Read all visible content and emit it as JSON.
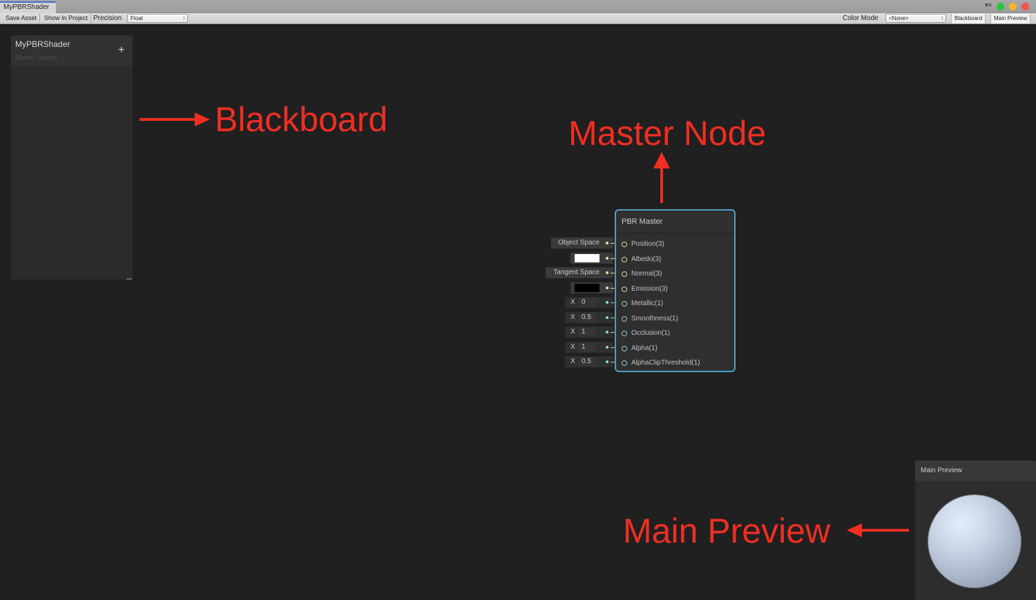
{
  "window": {
    "tab_title": "MyPBRShader",
    "controls": {
      "tab_menu_icon": "tab-menu-icon",
      "green": "#2fc23a",
      "yellow": "#f5b82a",
      "red": "#f25450"
    }
  },
  "toolbar": {
    "save_asset": "Save Asset",
    "show_in_project": "Show In Project",
    "precision_label": "Precision",
    "precision_value": "Float",
    "color_mode_label": "Color Mode",
    "color_mode_value": "<None>",
    "blackboard_toggle": "Blackboard",
    "main_preview_toggle": "Main Preview",
    "dropdown_arrow": "↕"
  },
  "blackboard": {
    "title": "MyPBRShader",
    "subtitle": "Shader Graphs",
    "add_icon": "+"
  },
  "annotations": {
    "color": "#f12e22",
    "blackboard": "Blackboard",
    "master_node": "Master Node",
    "main_preview": "Main Preview"
  },
  "master_node": {
    "title": "PBR Master",
    "accent": "#4da3c8",
    "ports": [
      {
        "label": "Position(3)",
        "type": "vector",
        "input": {
          "kind": "text",
          "value": "Object Space"
        }
      },
      {
        "label": "Albedo(3)",
        "type": "vector",
        "input": {
          "kind": "color",
          "value": "#ffffff"
        }
      },
      {
        "label": "Normal(3)",
        "type": "vector",
        "input": {
          "kind": "text",
          "value": "Tangent Space"
        }
      },
      {
        "label": "Emission(3)",
        "type": "vector",
        "input": {
          "kind": "color",
          "value": "#000000"
        }
      },
      {
        "label": "Metallic(1)",
        "type": "scalar",
        "input": {
          "kind": "float",
          "axis": "X",
          "value": "0"
        }
      },
      {
        "label": "Smoothness(1)",
        "type": "scalar",
        "input": {
          "kind": "float",
          "axis": "X",
          "value": "0.5"
        }
      },
      {
        "label": "Occlusion(1)",
        "type": "scalar",
        "input": {
          "kind": "float",
          "axis": "X",
          "value": "1"
        }
      },
      {
        "label": "Alpha(1)",
        "type": "scalar",
        "input": {
          "kind": "float",
          "axis": "X",
          "value": "1"
        }
      },
      {
        "label": "AlphaClipThreshold(1)",
        "type": "scalar",
        "input": {
          "kind": "float",
          "axis": "X",
          "value": "0.5"
        }
      }
    ]
  },
  "main_preview": {
    "title": "Main Preview",
    "object": "sphere"
  }
}
